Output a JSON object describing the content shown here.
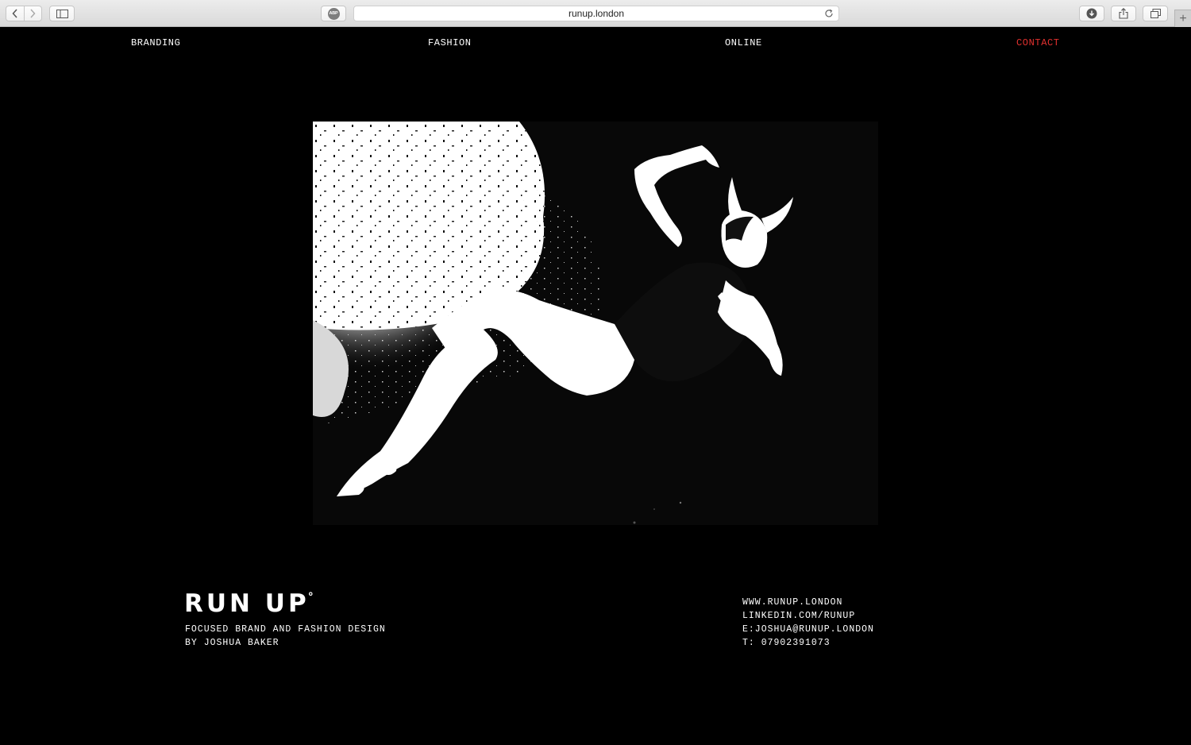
{
  "browser": {
    "url": "runup.london",
    "adblock_label": "ABP",
    "new_tab_label": "+"
  },
  "nav": {
    "items": [
      "BRANDING",
      "FASHION",
      "ONLINE",
      "CONTACT"
    ],
    "active_color": "#e4312f"
  },
  "hero": {
    "icon": "devil-woman-illustration"
  },
  "footer": {
    "logo": "RUN UP",
    "logo_mark": "°",
    "tagline_1": "FOCUSED BRAND AND FASHION DESIGN",
    "tagline_2": "BY JOSHUA BAKER",
    "contact": {
      "website": "WWW.RUNUP.LONDON",
      "linkedin": "LINKEDIN.COM/RUNUP",
      "email": "E:JOSHUA@RUNUP.LONDON",
      "phone": "T: 07902391073"
    }
  }
}
